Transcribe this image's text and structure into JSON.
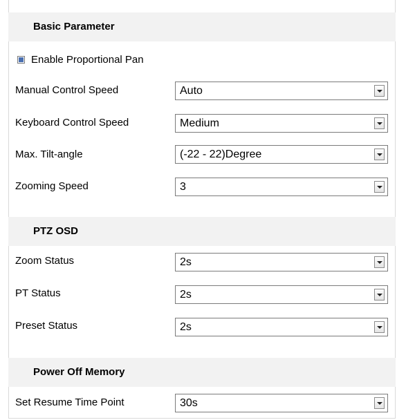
{
  "basic": {
    "title": "Basic Parameter",
    "proportional_pan_label": "Enable Proportional Pan",
    "proportional_pan_checked": true,
    "fields": [
      {
        "label": "Manual Control Speed",
        "value": "Auto"
      },
      {
        "label": "Keyboard Control Speed",
        "value": "Medium"
      },
      {
        "label": "Max. Tilt-angle",
        "value": "(-22 - 22)Degree"
      },
      {
        "label": "Zooming Speed",
        "value": "3"
      }
    ]
  },
  "osd": {
    "title": "PTZ OSD",
    "fields": [
      {
        "label": "Zoom Status",
        "value": "2s"
      },
      {
        "label": "PT Status",
        "value": "2s"
      },
      {
        "label": "Preset Status",
        "value": "2s"
      }
    ]
  },
  "memory": {
    "title": "Power Off Memory",
    "fields": [
      {
        "label": "Set Resume Time Point",
        "value": "30s"
      }
    ]
  }
}
